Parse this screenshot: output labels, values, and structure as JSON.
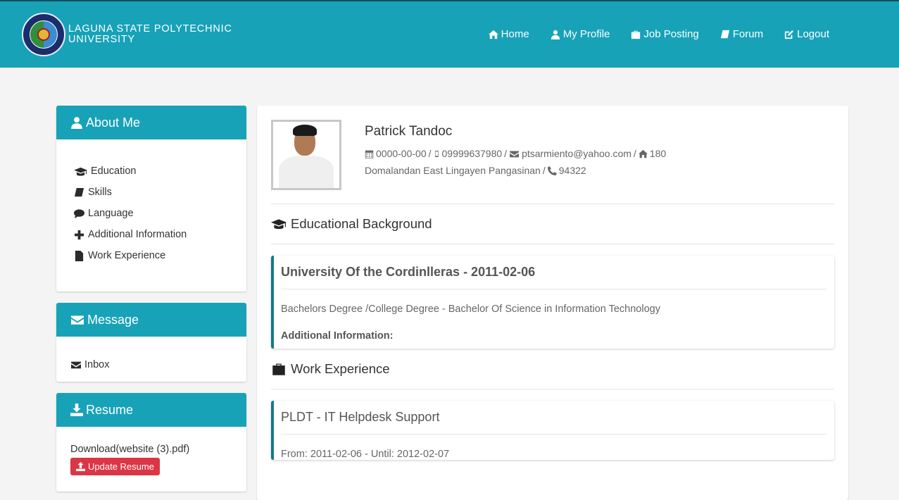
{
  "brand": {
    "line1": "LAGUNA STATE POLYTECHNIC",
    "line2": "UNIVERSITY",
    "logo_icon": "university-seal-logo"
  },
  "nav": [
    {
      "label": "Home",
      "icon": "home-icon"
    },
    {
      "label": "My Profile",
      "icon": "user-icon"
    },
    {
      "label": "Job Posting",
      "icon": "briefcase-icon"
    },
    {
      "label": "Forum",
      "icon": "book-icon"
    },
    {
      "label": "Logout",
      "icon": "edit-icon"
    }
  ],
  "sidebar": {
    "about": {
      "title": "About Me",
      "items": [
        {
          "label": "Education",
          "icon": "graduation-cap-icon"
        },
        {
          "label": "Skills",
          "icon": "book-icon"
        },
        {
          "label": "Language",
          "icon": "comment-icon"
        },
        {
          "label": "Additional Information",
          "icon": "plus-icon"
        },
        {
          "label": "Work Experience",
          "icon": "file-icon"
        }
      ]
    },
    "message": {
      "title": "Message",
      "items": [
        {
          "label": "Inbox",
          "icon": "envelope-icon"
        }
      ]
    },
    "resume": {
      "title": "Resume",
      "download_label": "Download(website (3).pdf)",
      "update_button": "Update Resume"
    }
  },
  "profile": {
    "name": "Patrick Tandoc",
    "birthdate": "0000-00-00",
    "mobile": "09999637980",
    "email": "ptsarmiento@yahoo.com",
    "address_no": "180",
    "address": "Domalandan East Lingayen Pangasinan",
    "phone": "94322",
    "separator": "/"
  },
  "education": {
    "section_title": "Educational Background",
    "entries": [
      {
        "school_date": "University Of the Cordinlleras - 2011-02-06",
        "degree": "Bachelors Degree /College Degree - Bachelor Of Science in Information Technology",
        "additional_label": "Additional Information:"
      }
    ]
  },
  "work": {
    "section_title": "Work Experience",
    "entries": [
      {
        "company_position": "PLDT - IT Helpdesk Support",
        "period": "From: 2011-02-06 - Until: 2012-02-07"
      }
    ]
  },
  "colors": {
    "primary": "#17a2b8",
    "accent_border": "#117a8b",
    "danger": "#dc3545"
  }
}
